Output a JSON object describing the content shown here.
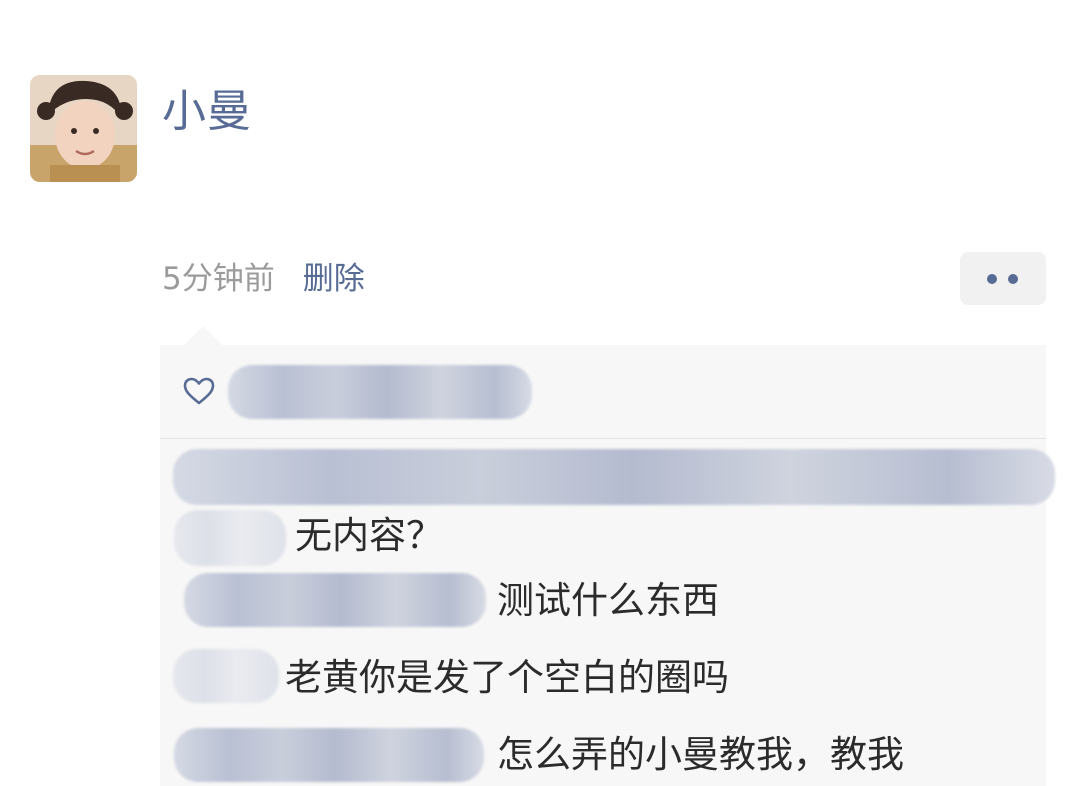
{
  "post": {
    "username": "小曼",
    "time": "5分钟前",
    "delete_label": "删除"
  },
  "icons": {
    "more": "more-dots-icon",
    "like": "heart-icon"
  },
  "colors": {
    "link": "#576b95",
    "meta": "#9b9b9b",
    "panel": "#f7f7f7"
  },
  "comments": [
    {
      "text": "无内容？"
    },
    {
      "text": "测试什么东西"
    },
    {
      "text": "老黄你是发了个空白的圈吗"
    },
    {
      "text": "怎么弄的小曼教我，教我"
    }
  ]
}
